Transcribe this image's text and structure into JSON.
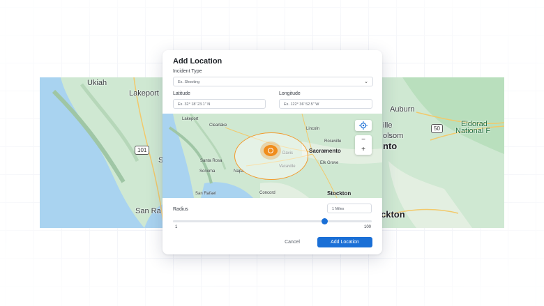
{
  "background_map": {
    "labels": {
      "ukiah": "Ukiah",
      "lakeport": "Lakeport",
      "santa_rosa_partial": "S",
      "san_ra_partial": "San Ra",
      "auburn": "Auburn",
      "ville_partial": "ille",
      "folsom_partial": "olsom",
      "nto_partial": "nto",
      "eldorado": "Eldorad",
      "national_forest": "National F",
      "ckton_partial": "ckton"
    },
    "shields": {
      "us101": "101",
      "us50": "50"
    }
  },
  "modal": {
    "title": "Add Location",
    "incident_type": {
      "label": "Incident Type",
      "placeholder": "Ex. Shooting"
    },
    "latitude": {
      "label": "Latitude",
      "placeholder": "Ex. 32° 18' 23.1\" N"
    },
    "longitude": {
      "label": "Longitude",
      "placeholder": "Ex. 122° 36' 52.5\" W"
    },
    "map": {
      "labels": {
        "lakeport": "Lakeport",
        "clearlake": "Clearlake",
        "lincoln": "Lincoln",
        "roseville": "Roseville",
        "sacramento": "Sacramento",
        "santa_rosa": "Santa Rosa",
        "sonoma": "Sonoma",
        "elk_grove": "Elk Grove",
        "san_rafael": "San Rafael",
        "stockton": "Stockton",
        "concord": "Concord",
        "davis": "Davis",
        "vacaville": "Vacaville",
        "napa": "Napa"
      },
      "controls": {
        "zoom_out": "−",
        "zoom_in": "+"
      }
    },
    "radius": {
      "label": "Radius",
      "value": "1 Miles",
      "min": "1",
      "max": "100",
      "slider_fraction": 0.76
    },
    "buttons": {
      "cancel": "Cancel",
      "add": "Add Location"
    }
  },
  "colors": {
    "accent": "#1a6fd6",
    "pin": "#f08c1b",
    "map_land": "#cfe8d2",
    "map_water": "#a9d3f0"
  }
}
